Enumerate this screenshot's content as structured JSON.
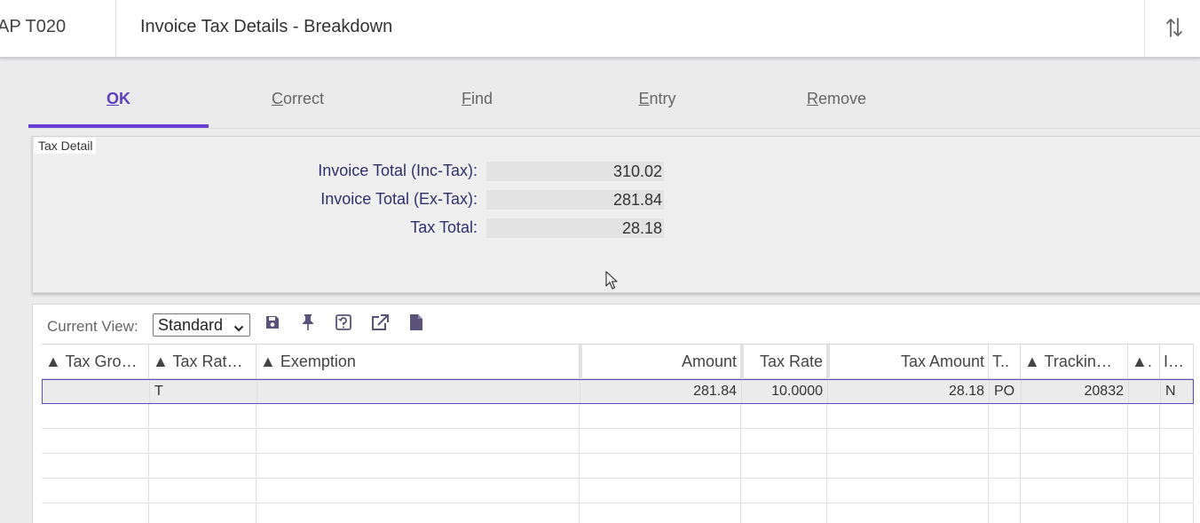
{
  "header": {
    "app_code": "AP T020",
    "title": "Invoice Tax Details - Breakdown"
  },
  "tabs": [
    {
      "label_first": "O",
      "label_rest": "K",
      "active": true
    },
    {
      "label_first": "C",
      "label_rest": "orrect",
      "active": false
    },
    {
      "label_first": "F",
      "label_rest": "ind",
      "active": false
    },
    {
      "label_first": "E",
      "label_rest": "ntry",
      "active": false
    },
    {
      "label_first": "R",
      "label_rest": "emove",
      "active": false
    }
  ],
  "tax_detail": {
    "title": "Tax Detail",
    "fields": [
      {
        "label": "Invoice Total (Inc-Tax):",
        "value": "310.02"
      },
      {
        "label": "Invoice Total (Ex-Tax):",
        "value": "281.84"
      },
      {
        "label": "Tax Total:",
        "value": "28.18"
      }
    ]
  },
  "grid": {
    "view_label": "Current View:",
    "view_selected": "Standard",
    "toolbar_icons": [
      "save-icon",
      "pin-icon",
      "restore-layout-icon",
      "export-icon",
      "document-icon"
    ],
    "columns": [
      "▲ Tax Gro…",
      "▲ Tax Rat…",
      "▲ Exemption",
      "Amount",
      "Tax Rate",
      "Tax Amount",
      "T..",
      "▲ Trackin…",
      "▲.",
      "I…"
    ],
    "rows": [
      [
        "",
        "T",
        "",
        "281.84",
        "10.0000",
        "28.18",
        "PO",
        "20832",
        "",
        "N"
      ]
    ]
  }
}
